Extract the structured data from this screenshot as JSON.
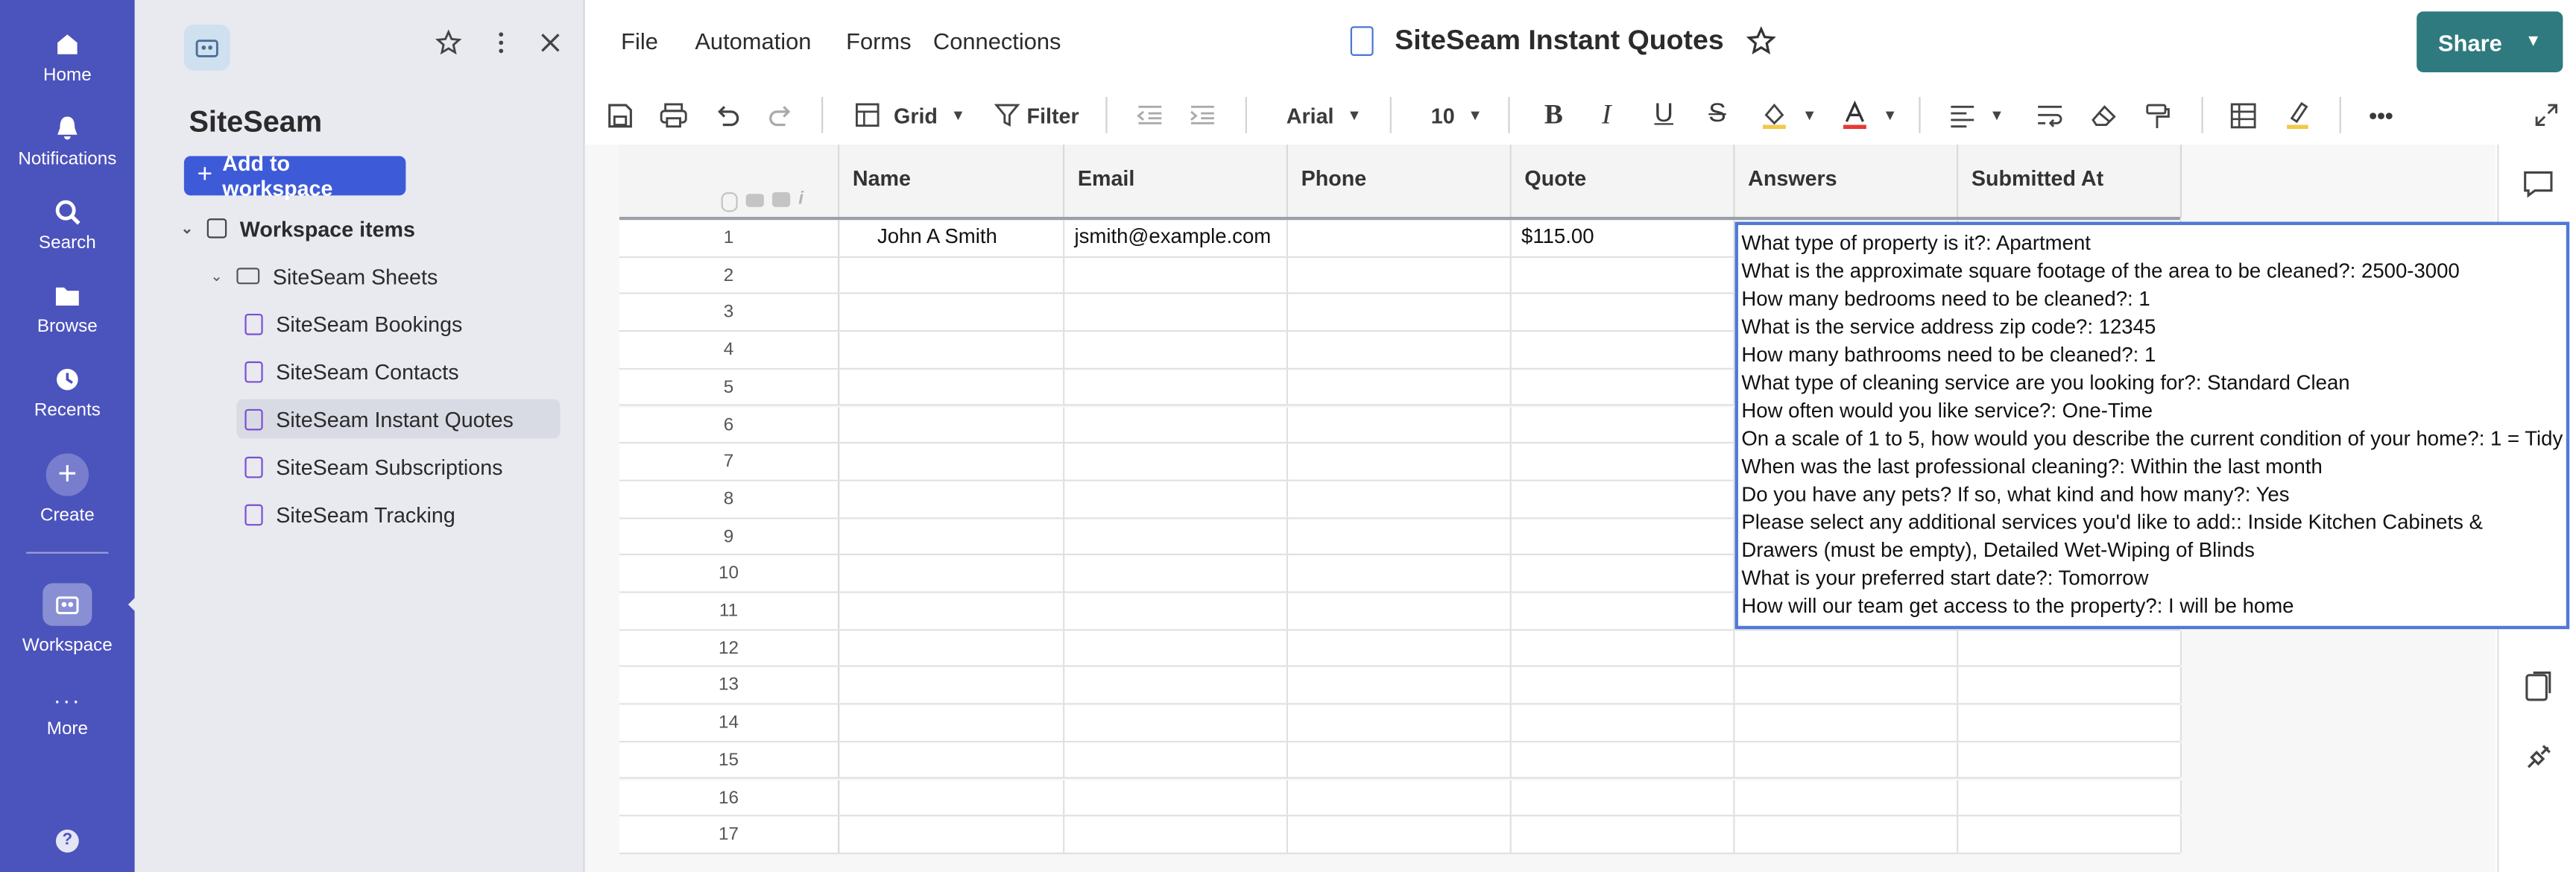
{
  "rail": {
    "items": [
      {
        "label": "Home",
        "icon": "home-icon"
      },
      {
        "label": "Notifications",
        "icon": "bell-icon"
      },
      {
        "label": "Search",
        "icon": "search-icon"
      },
      {
        "label": "Browse",
        "icon": "folder-icon"
      },
      {
        "label": "Recents",
        "icon": "clock-icon"
      },
      {
        "label": "Create",
        "icon": "plus-icon"
      },
      {
        "label": "Workspace",
        "icon": "workspace-icon"
      },
      {
        "label": "More",
        "icon": "more-icon"
      }
    ],
    "help": "?"
  },
  "panel": {
    "title": "SiteSeam",
    "add_label": "Add to workspace",
    "workspace_items": "Workspace items",
    "folder": "SiteSeam Sheets",
    "sheets": [
      "SiteSeam Bookings",
      "SiteSeam Contacts",
      "SiteSeam Instant Quotes",
      "SiteSeam Subscriptions",
      "SiteSeam Tracking"
    ],
    "selected": "SiteSeam Instant Quotes"
  },
  "menu": [
    "File",
    "Automation",
    "Forms",
    "Connections"
  ],
  "doc_title": "SiteSeam Instant Quotes",
  "share_label": "Share",
  "toolbar": {
    "view": "Grid",
    "filter": "Filter",
    "font": "Arial",
    "size": "10",
    "more": "•••"
  },
  "columns": [
    "Name",
    "Email",
    "Phone",
    "Quote",
    "Answers",
    "Submitted At"
  ],
  "row_numbers": [
    "1",
    "2",
    "3",
    "4",
    "5",
    "6",
    "7",
    "8",
    "9",
    "10",
    "11",
    "12",
    "13",
    "14",
    "15",
    "16",
    "17"
  ],
  "row1": {
    "name": "John A Smith",
    "email": "jsmith@example.com",
    "phone": "",
    "quote": "$115.00"
  },
  "answers": [
    "What type of property is it?: Apartment",
    "What is the approximate square footage of the area to be cleaned?: 2500-3000",
    "How many bedrooms need to be cleaned?: 1",
    "What is the service address zip code?: 12345",
    "How many bathrooms need to be cleaned?: 1",
    "What type of cleaning service are you looking for?: Standard Clean",
    "How often would you like service?: One-Time",
    "On a scale of 1 to 5, how would you describe the current condition of your home?: 1 = Tidy",
    "When was the last professional cleaning?: Within the last month",
    "Do you have any pets? If so, what kind and how many?: Yes",
    "Please select any additional services you'd like to add:: Inside Kitchen Cabinets & Drawers (must be empty), Detailed Wet-Wiping of Blinds",
    "What is your preferred start date?: Tomorrow",
    "How will our team get access to the property?: I will be home"
  ],
  "colors": {
    "rail": "#4b53bc",
    "panel": "#e8eaf0",
    "share": "#2f7a7e",
    "add_button": "#3d5bd9",
    "selection": "#5079d6"
  }
}
